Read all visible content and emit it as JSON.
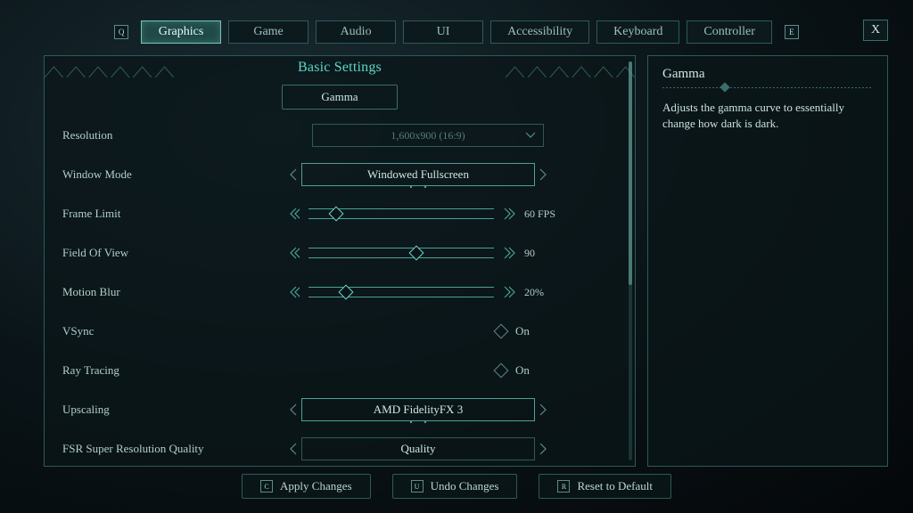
{
  "tabs": {
    "prev_key": "Q",
    "next_key": "E",
    "items": [
      "Graphics",
      "Game",
      "Audio",
      "UI",
      "Accessibility",
      "Keyboard",
      "Controller"
    ],
    "active": 0
  },
  "close_label": "X",
  "section_title": "Basic Settings",
  "gamma_button": "Gamma",
  "settings": {
    "resolution": {
      "label": "Resolution",
      "value": "1,600x900 (16:9)"
    },
    "window_mode": {
      "label": "Window Mode",
      "value": "Windowed Fullscreen"
    },
    "frame_limit": {
      "label": "Frame Limit",
      "value": "60 FPS",
      "pct": 15
    },
    "fov": {
      "label": "Field Of View",
      "value": "90",
      "pct": 58
    },
    "motion_blur": {
      "label": "Motion Blur",
      "value": "20%",
      "pct": 20
    },
    "vsync": {
      "label": "VSync",
      "value": "On"
    },
    "ray_tracing": {
      "label": "Ray Tracing",
      "value": "On"
    },
    "upscaling": {
      "label": "Upscaling",
      "value": "AMD FidelityFX 3"
    },
    "fsr_quality": {
      "label": "FSR Super Resolution Quality",
      "value": "Quality"
    }
  },
  "info": {
    "title": "Gamma",
    "body": "Adjusts the gamma curve to essentially change how dark is dark."
  },
  "bottom": {
    "apply": {
      "key": "C",
      "label": "Apply Changes"
    },
    "undo": {
      "key": "U",
      "label": "Undo Changes"
    },
    "reset": {
      "key": "R",
      "label": "Reset to Default"
    }
  }
}
